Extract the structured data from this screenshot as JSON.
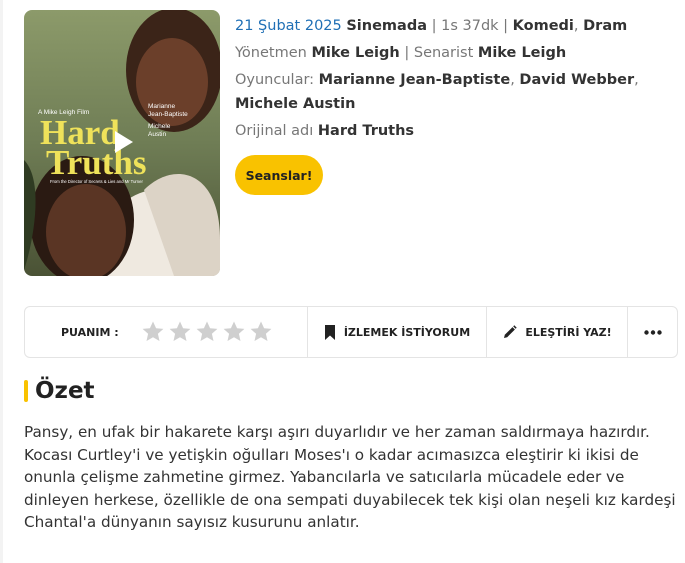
{
  "movie": {
    "poster": {
      "overlay_credit": "A Mike Leigh Film",
      "overlay_title_line1": "Hard",
      "overlay_title_line2": "Truths",
      "overlay_actor1_line1": "Marianne",
      "overlay_actor1_line2": "Jean-Baptiste",
      "overlay_actor2_line1": "Michele",
      "overlay_actor2_line2": "Austin",
      "overlay_tagline": "From the Director of Secrets & Lies and Mr Turner",
      "play_icon": "play-icon"
    },
    "release_date": "21 Şubat 2025",
    "release_status": "Sinemada",
    "duration": "1s 37dk",
    "genre1": "Komedi",
    "genre2": "Dram",
    "director_label": "Yönetmen",
    "director": "Mike Leigh",
    "writer_label": "Senarist",
    "writer": "Mike Leigh",
    "cast_label": "Oyuncular:",
    "cast1": "Marianne Jean-Baptiste",
    "cast2": "David Webber",
    "cast3": "Michele Austin",
    "original_label": "Orijinal adı",
    "original_title": "Hard Truths"
  },
  "buttons": {
    "showtimes": "Seanslar!"
  },
  "actionbar": {
    "rating_label": "PUANIM :",
    "rating_stars": 0,
    "rating_max": 5,
    "watchlist_label": "İZLEMEK İSTİYORUM",
    "review_label": "ELEŞTİRİ YAZ!",
    "more_icon": "more-dots-icon"
  },
  "summary": {
    "heading": "Özet",
    "text": "Pansy, en ufak bir hakarete karşı aşırı duyarlıdır ve her zaman saldırmaya hazırdır. Kocası Curtley'i ve yetişkin oğulları Moses'ı o kadar acımasızca eleştirir ki ikisi de onunla çelişme zahmetine girmez. Yabancılarla ve satıcılarla mücadele eder ve dinleyen herkese, özellikle de ona sempati duyabilecek tek kişi olan neşeli kız kardeşi Chantal'a dünyanın sayısız kusurunu anlatır."
  },
  "colors": {
    "accent_yellow": "#f9c200",
    "link_blue": "#1f6fb5",
    "star_gray": "#cfcfcf"
  }
}
